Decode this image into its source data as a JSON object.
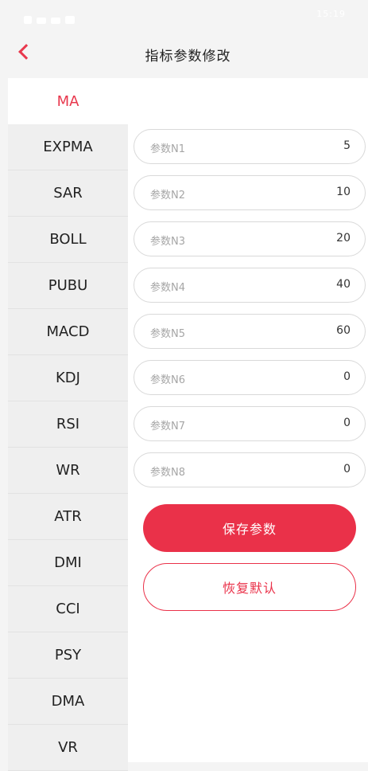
{
  "header": {
    "title": "指标参数修改"
  },
  "status": {
    "time": "15:19"
  },
  "sidebar": {
    "items": [
      {
        "label": "MA",
        "active": true
      },
      {
        "label": "EXPMA"
      },
      {
        "label": "SAR"
      },
      {
        "label": "BOLL"
      },
      {
        "label": "PUBU"
      },
      {
        "label": "MACD"
      },
      {
        "label": "KDJ"
      },
      {
        "label": "RSI"
      },
      {
        "label": "WR"
      },
      {
        "label": "ATR"
      },
      {
        "label": "DMI"
      },
      {
        "label": "CCI"
      },
      {
        "label": "PSY"
      },
      {
        "label": "DMA"
      },
      {
        "label": "VR"
      }
    ]
  },
  "params": [
    {
      "label": "参数N1",
      "value": "5"
    },
    {
      "label": "参数N2",
      "value": "10"
    },
    {
      "label": "参数N3",
      "value": "20"
    },
    {
      "label": "参数N4",
      "value": "40"
    },
    {
      "label": "参数N5",
      "value": "60"
    },
    {
      "label": "参数N6",
      "value": "0"
    },
    {
      "label": "参数N7",
      "value": "0"
    },
    {
      "label": "参数N8",
      "value": "0"
    }
  ],
  "buttons": {
    "save": "保存参数",
    "reset": "恢复默认"
  },
  "colors": {
    "accent": "#ea3149"
  }
}
